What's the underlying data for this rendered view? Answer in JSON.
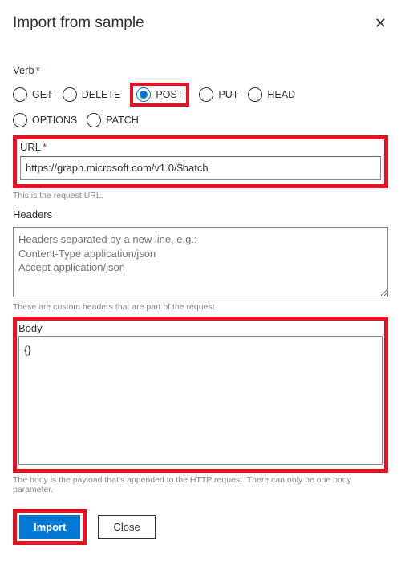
{
  "dialog": {
    "title": "Import from sample"
  },
  "verb": {
    "label": "Verb",
    "options": {
      "get": "GET",
      "delete": "DELETE",
      "post": "POST",
      "put": "PUT",
      "head": "HEAD",
      "options": "OPTIONS",
      "patch": "PATCH"
    },
    "selected": "post"
  },
  "url": {
    "label": "URL",
    "value": "https://graph.microsoft.com/v1.0/$batch",
    "help": "This is the request URL."
  },
  "headers": {
    "label": "Headers",
    "placeholder": "Headers separated by a new line, e.g.:\nContent-Type application/json\nAccept application/json",
    "help": "These are custom headers that are part of the request."
  },
  "body": {
    "label": "Body",
    "value": "{}",
    "help": "The body is the payload that's appended to the HTTP request. There can only be one body parameter."
  },
  "buttons": {
    "import": "Import",
    "close": "Close"
  }
}
